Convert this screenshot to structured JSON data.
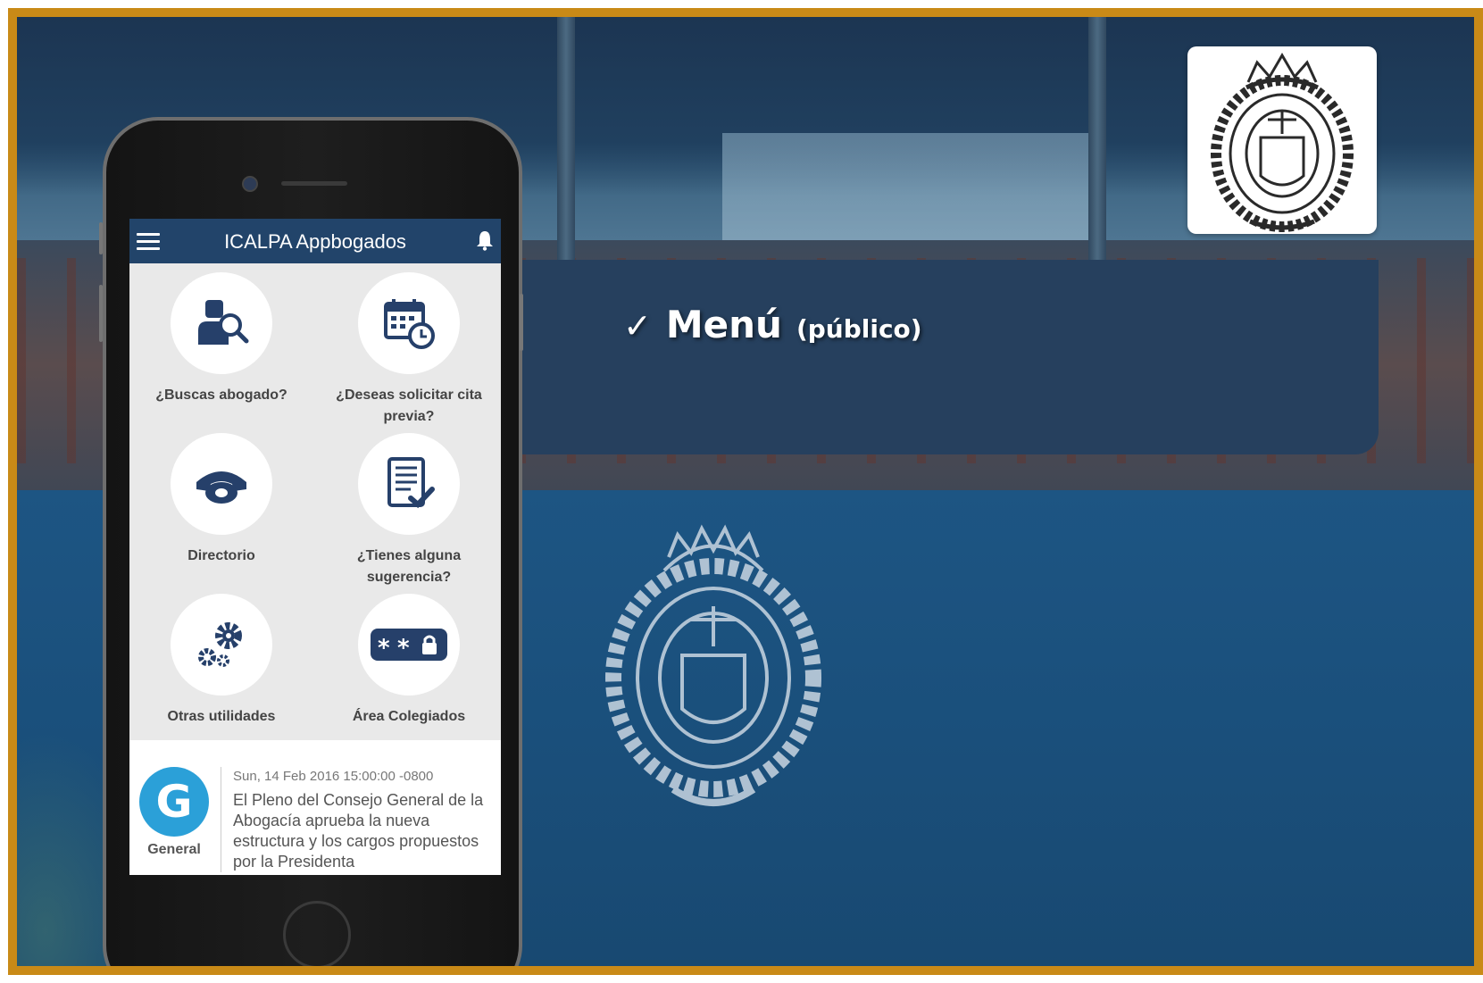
{
  "app": {
    "title": "ICALPA Appbogados",
    "menu_icon": "hamburger-menu-icon",
    "notification_icon": "bell-icon"
  },
  "menu_items": [
    {
      "label": "¿Buscas abogado?",
      "icon": "lawyer-search-icon"
    },
    {
      "label": "¿Deseas solicitar cita previa?",
      "icon": "calendar-clock-icon"
    },
    {
      "label": "Directorio",
      "icon": "telephone-icon"
    },
    {
      "label": "¿Tienes alguna sugerencia?",
      "icon": "document-check-icon"
    },
    {
      "label": "Otras utilidades",
      "icon": "gears-icon"
    },
    {
      "label": "Área Colegiados",
      "icon": "password-lock-icon"
    }
  ],
  "news": {
    "category": "General",
    "category_icon": "general-g-icon",
    "icon_letter": "G",
    "date": "Sun, 14 Feb 2016 15:00:00 -0800",
    "text": "El Pleno del Consejo General de la Abogacía aprueba la nueva estructura y los cargos propuestos por la Presidenta"
  },
  "panel": {
    "check": "✓",
    "title": "Menú",
    "subtitle": "(público)"
  },
  "colors": {
    "frame": "#c98a17",
    "app_bar": "#22446a",
    "panel": "#26405e",
    "news_icon": "#2ba0d8"
  }
}
